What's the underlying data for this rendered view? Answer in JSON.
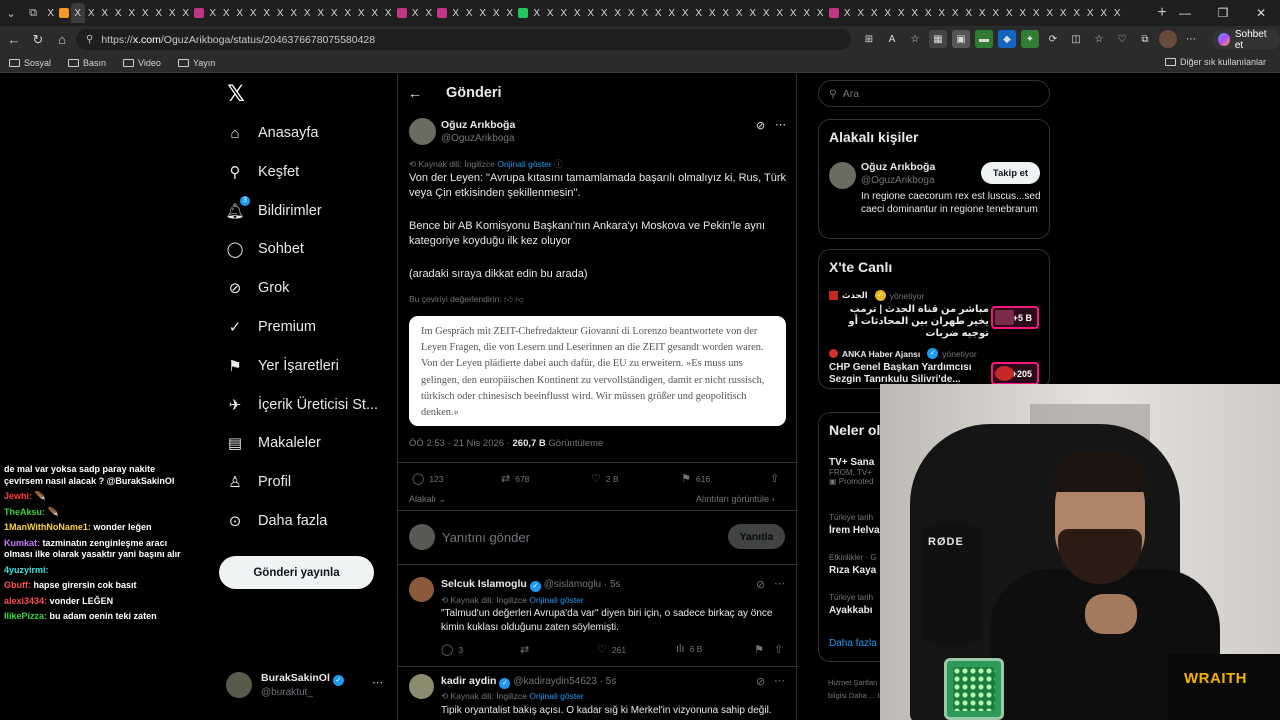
{
  "browser": {
    "url_prefix": "https://",
    "url_site": "x.com",
    "url_path": "/OguzArikboga/status/2046376678075580428",
    "copilot_label": "Sohbet et",
    "bookmarks": [
      "Sosyal",
      "Basın",
      "Video",
      "Yayın"
    ],
    "bookmarks_other": "Diğer sık kullanılanlar"
  },
  "nav": {
    "items": [
      {
        "label": "Anasayfa",
        "icon": "home-icon"
      },
      {
        "label": "Keşfet",
        "icon": "search-icon"
      },
      {
        "label": "Bildirimler",
        "icon": "bell-icon",
        "badge": "3"
      },
      {
        "label": "Sohbet",
        "icon": "chat-icon"
      },
      {
        "label": "Grok",
        "icon": "grok-icon"
      },
      {
        "label": "Premium",
        "icon": "premium-icon"
      },
      {
        "label": "Yer İşaretleri",
        "icon": "bookmark-icon"
      },
      {
        "label": "İçerik Üreticisi St...",
        "icon": "rocket-icon"
      },
      {
        "label": "Makaleler",
        "icon": "article-icon"
      },
      {
        "label": "Profil",
        "icon": "person-icon"
      },
      {
        "label": "Daha fazla",
        "icon": "more-circle-icon"
      }
    ],
    "post_button": "Gönderi yayınla",
    "account_name": "BurakSakinOl",
    "account_handle": "@buraktut_"
  },
  "chat": [
    {
      "user": "",
      "text": "de mal var yoksa sadp paray nakite çevirsem nasıl alacak ? @BurakSakinOl",
      "color": "#ffffff"
    },
    {
      "user": "Jewhi:",
      "text": "🪶",
      "color": "#ff3b3b"
    },
    {
      "user": "TheAksu:",
      "text": "🪶",
      "color": "#3bd13b"
    },
    {
      "user": "1ManWithNoName1:",
      "text": "wonder leğen",
      "color": "#ffd23b"
    },
    {
      "user": "Kumkat:",
      "text": "tazminatın zenginleşme aracı olması ilke olarak yasaktır yani başını alır",
      "color": "#c77dff"
    },
    {
      "user": "4yuzyirmi:",
      "text": "",
      "color": "#3ee0e0"
    },
    {
      "user": "Gbuff:",
      "text": "hapse girersin cok basıt",
      "color": "#ff5050"
    },
    {
      "user": "alexi3434:",
      "text": "vonder LEĞEN",
      "color": "#ff5050"
    },
    {
      "user": "IlikePizza:",
      "text": "bu adam oenin teki zaten",
      "color": "#3bd13b"
    }
  ],
  "post": {
    "header_title": "Gönderi",
    "author_name": "Oğuz Arıkboğa",
    "author_handle": "@OguzArikboga",
    "source_lang": "Kaynak dili: İngilizce",
    "show_original": "Orijinali göster",
    "para1": "Von der Leyen: \"Avrupa kıtasını tamamlamada başarılı olmalıyız ki, Rus, Türk veya Çin etkisinden şekillenmesin\".",
    "para2": "Bence bir AB Komisyonu Başkanı'nın Ankara'yı Moskova ve Pekin'le aynı kategoriye koyduğu ilk kez oluyor",
    "para3": "(aradaki sıraya dikkat edin bu arada)",
    "rate_translation": "Bu çeviriyi değerlendirin:",
    "quote": "Im Gespräch mit ZEIT-Chefredakteur Giovanni di Lorenzo beantwortete von der Leyen Fragen, die von Lesern und Leserinnen an die ZEIT gesandt worden waren. Von der Leyen plädierte dabei auch dafür, die EU zu erweitern. »Es muss uns gelingen, den europäischen Kontinent zu vervollständigen, damit er nicht russisch, türkisch oder chinesisch beeinflusst wird. Wir müssen größer und geopolitisch denken.«",
    "time": "ÖÖ 2:53 · 21 Nis 2026 ·",
    "views_count": "260,7 B",
    "views_label": "Görüntüleme",
    "replies": "123",
    "reposts": "678",
    "likes": "2 B",
    "bookmarks": "616",
    "relevant": "Alakalı",
    "quotes_view": "Alıntıları görüntüle",
    "reply_placeholder": "Yanıtını gönder",
    "reply_button": "Yanıtla"
  },
  "replies": [
    {
      "name": "Selcuk Islamoglu",
      "handle": "@sislamoglu · 5s",
      "source": "Kaynak dili: İngilizce",
      "show": "Orijinali göster",
      "text": "\"Talmud'un değerleri Avrupa'da var\" diyen biri için, o sadece birkaç ay önce kimin kuklası olduğunu zaten söylemişti.",
      "replies": "3",
      "likes": "261",
      "views": "6 B"
    },
    {
      "name": "kadir aydin",
      "handle": "@kadiraydin54623 · 5s",
      "source": "Kaynak dili: İngilizce",
      "show": "Orijinali göster",
      "text": "Tipik oryantalist bakış açısı. O kadar sığ ki Merkel'in vizyonuna sahip değil."
    }
  ],
  "right": {
    "search_placeholder": "Ara",
    "related_title": "Alakalı kişiler",
    "related_name": "Oğuz Arıkboğa",
    "related_handle": "@OguzArikboga",
    "related_bio": "In regione caecorum rex est luscus...sed caeci dominantur in regione tenebrarum",
    "follow_button": "Takip et",
    "live_title": "X'te Canlı",
    "live": [
      {
        "host": "الحدث",
        "status": "yönetiyor",
        "text": "مباشر من قناة الحدث | ترمب يخير طهران بين المحادثات أو توجيه ضربات",
        "badge": "+5 B"
      },
      {
        "host": "ANKA Haber Ajansı",
        "status": "yönetiyor",
        "text": "CHP Genel Başkan Yardımcısı Sezgin Tanrıkulu Silivri'de...",
        "badge": "+205"
      }
    ],
    "trends_title": "Neler ol",
    "trends": [
      {
        "meta": "TV+ Sana",
        "name": "FROM, TV+",
        "promoted": "Promoted"
      },
      {
        "meta": "Türkiye tarih",
        "name": "İrem Helva"
      },
      {
        "meta": "Etkinlikler · G",
        "name": "Rıza Kaya"
      },
      {
        "meta": "Türkiye tarih",
        "name": "Ayakkabı"
      }
    ],
    "show_more": "Daha fazla",
    "footer": "Hizmet Şartları   Gizlilik Politikası   Çerez Politikası   Erişilebilirlik   Reklam bilgisi   Daha ...   Imprint   © 2026 X Corp."
  },
  "overlay": {
    "mic_brand": "RØDE",
    "sponsor": "WRAITH"
  }
}
